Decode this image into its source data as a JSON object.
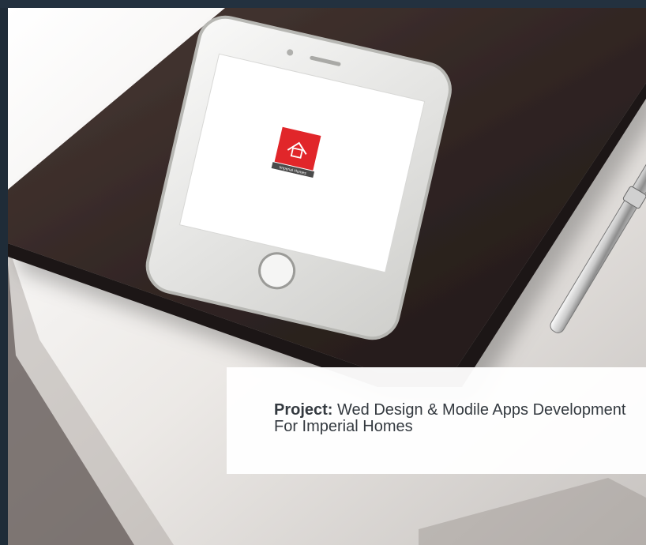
{
  "caption": {
    "label": "Project:",
    "text": "Wed Design & Modile Apps Development For Imperial Homes"
  },
  "image": {
    "logo_text": "Imperial Homes"
  },
  "colors": {
    "frame": "#233142",
    "logo_red": "#e1262a",
    "card": "#ffffff",
    "caption_text": "#343a40"
  },
  "icons": {
    "logo": "house-logo-icon"
  }
}
